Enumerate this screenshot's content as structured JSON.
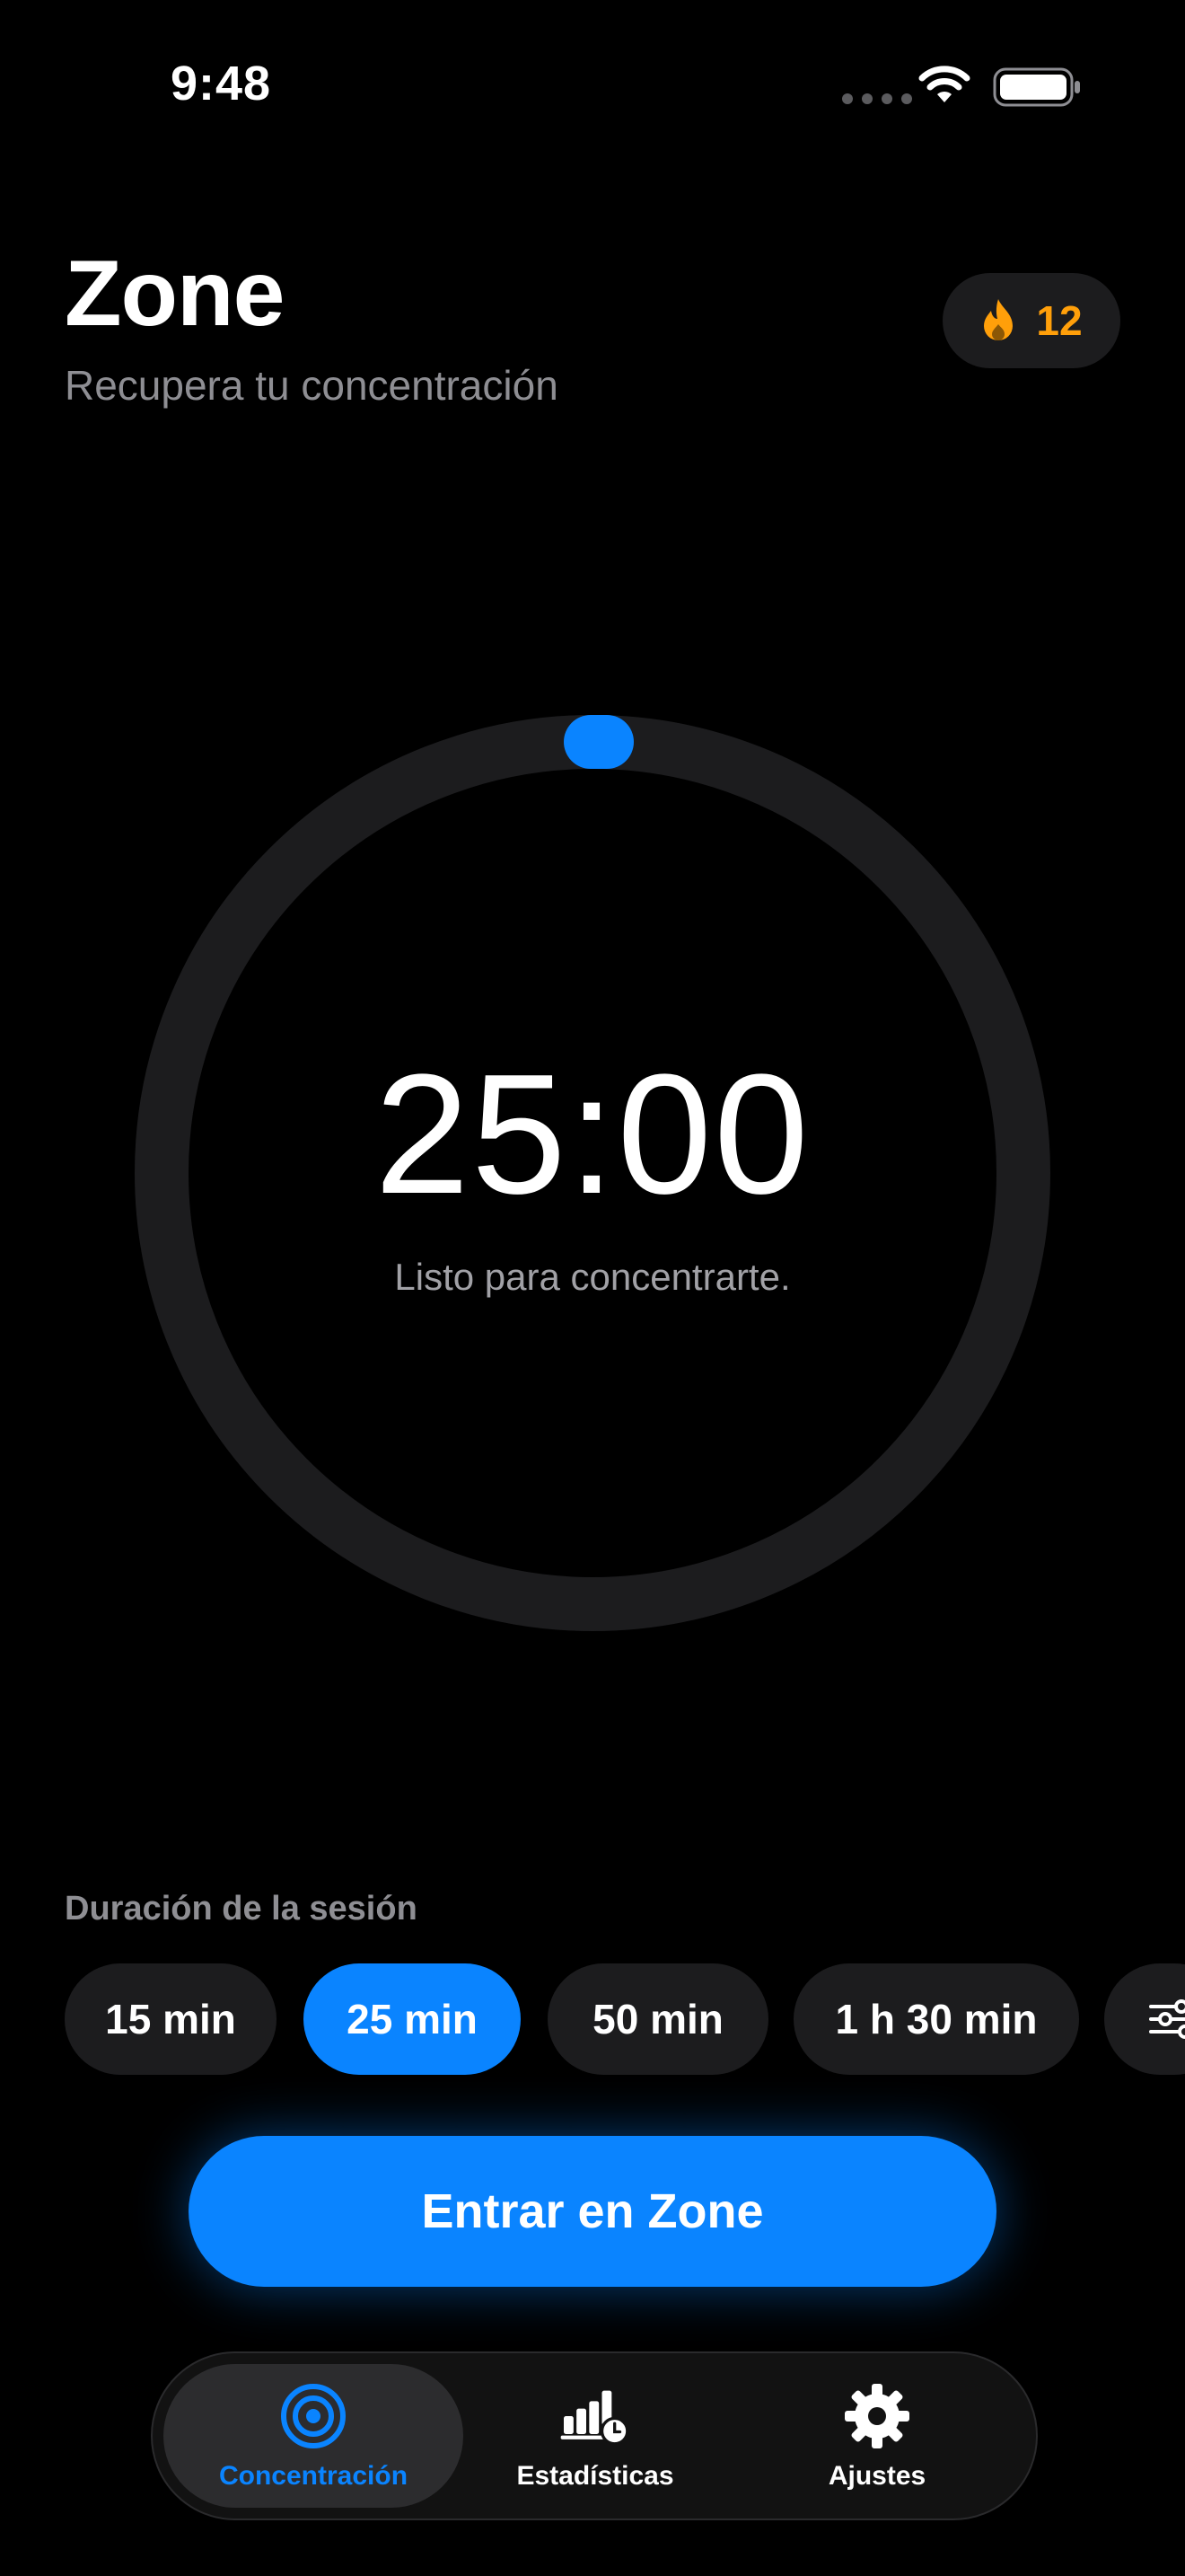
{
  "status_bar": {
    "time": "9:48"
  },
  "header": {
    "title": "Zone",
    "subtitle": "Recupera tu concentración",
    "streak": {
      "icon": "flame-icon",
      "count": "12"
    }
  },
  "timer": {
    "value": "25:00",
    "status": "Listo para concentrarte.",
    "progress": 0
  },
  "duration": {
    "label": "Duración de la sesión",
    "options": [
      {
        "label": "15 min",
        "selected": false
      },
      {
        "label": "25 min",
        "selected": true
      },
      {
        "label": "50 min",
        "selected": false
      },
      {
        "label": "1 h 30 min",
        "selected": false
      }
    ],
    "custom_icon": "sliders-icon"
  },
  "cta": {
    "label": "Entrar en Zone"
  },
  "tabs": [
    {
      "label": "Concentración",
      "icon": "target-icon",
      "active": true
    },
    {
      "label": "Estadísticas",
      "icon": "stats-chart-icon",
      "active": false
    },
    {
      "label": "Ajustes",
      "icon": "gear-icon",
      "active": false
    }
  ],
  "colors": {
    "accent": "#0a84ff",
    "streak": "#ff9f0a",
    "background": "#000000",
    "surface": "#1c1c1e"
  }
}
